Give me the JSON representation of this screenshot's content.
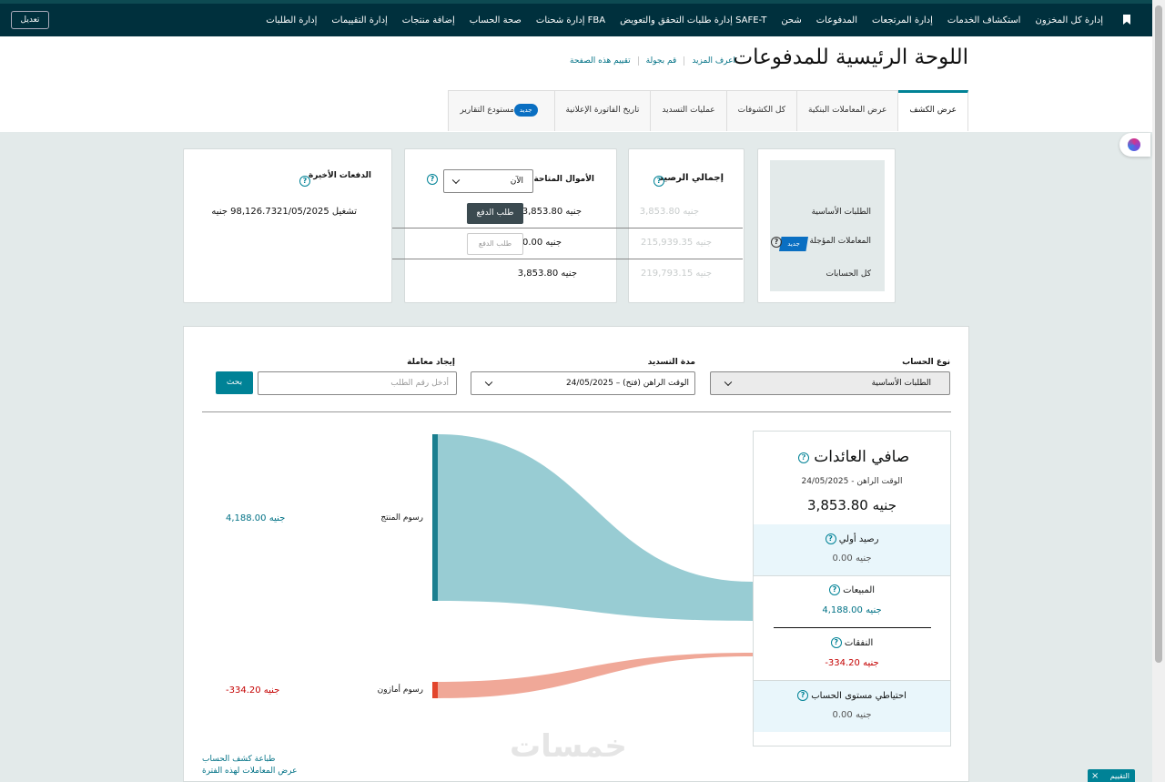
{
  "nav": {
    "items": [
      "إدارة كل المخزون",
      "استكشاف الخدمات",
      "إدارة المرتجعات",
      "المدفوعات",
      "شحن",
      "إدارة طلبات التحقق والتعويض SAFE-T",
      "إدارة شحنات FBA",
      "صحة الحساب",
      "إضافة منتجات",
      "إدارة التقييمات",
      "إدارة الطلبات"
    ],
    "edit_label": "تعديل"
  },
  "header": {
    "title": "اللوحة الرئيسية للمدفوعات",
    "links": [
      "اعرف المزيد",
      "قم بجولة",
      "تقييم هذه الصفحة"
    ]
  },
  "tabs": [
    {
      "label": "عرض الكشف",
      "active": true
    },
    {
      "label": "عرض المعاملات البنكية"
    },
    {
      "label": "كل الكشوفات"
    },
    {
      "label": "عمليات التسديد"
    },
    {
      "label": "تاريخ الفاتورة الإعلانية"
    },
    {
      "label": "مستودع التقارير",
      "badge": "جديد"
    }
  ],
  "labels_card": {
    "rows": [
      "الطلبات الأساسية",
      "المعاملات المؤجلة",
      "كل الحسابات"
    ],
    "badge": "جديد"
  },
  "balance_card": {
    "title": "إجمالي الرصيد",
    "values": [
      "3,853.80 جنيه",
      "215,939.35 جنيه",
      "219,793.15 جنيه"
    ]
  },
  "funds_card": {
    "title": "الأموال المتاحة",
    "select_value": "الآن",
    "values": [
      "3,853.80 جنيه",
      "0.00 جنيه",
      "3,853.80 جنيه"
    ],
    "request_label": "طلب الدفع"
  },
  "recent_card": {
    "title": "الدفعات الأخيرة",
    "row1": "تشغيل 98,126.7321/05/2025 جنيه"
  },
  "filters": {
    "account_type_label": "نوع الحساب",
    "account_type_value": "الطلبات الأساسية",
    "period_label": "مدة التسديد",
    "period_value": "24/05/2025 – الوقت الراهن (فتح)",
    "find_label": "إيجاد معاملة",
    "find_placeholder": "أدخل رقم الطلب",
    "search_label": "بحث"
  },
  "summary": {
    "title": "صافي العائدات",
    "period": "24/05/2025 - الوقت الراهن",
    "total": "3,853.80 جنيه",
    "opening_label": "رصيد أولي",
    "opening_value": "0.00 جنيه",
    "sales_label": "المبيعات",
    "sales_value": "4,188.00 جنيه",
    "expenses_label": "النفقات",
    "expenses_value": "-334.20 جنيه",
    "reserve_label": "احتياطي مستوى الحساب",
    "reserve_value": "0.00 جنيه"
  },
  "flow": {
    "product_fees_label": "رسوم المنتج",
    "product_fees_value": "4,188.00 جنيه",
    "amazon_fees_label": "رسوم أمازون",
    "amazon_fees_value": "-334.20 جنيه",
    "colors": {
      "teal": "#98ccd3",
      "teal_bar": "#1a7f8f",
      "red": "#f0a898",
      "red_bar": "#e2462d"
    }
  },
  "bottom_links": [
    "طباعة كشف الحساب",
    "عرض المعاملات لهذه الفترة"
  ],
  "watermark": "خمسات",
  "feedback_label": "التقييم"
}
